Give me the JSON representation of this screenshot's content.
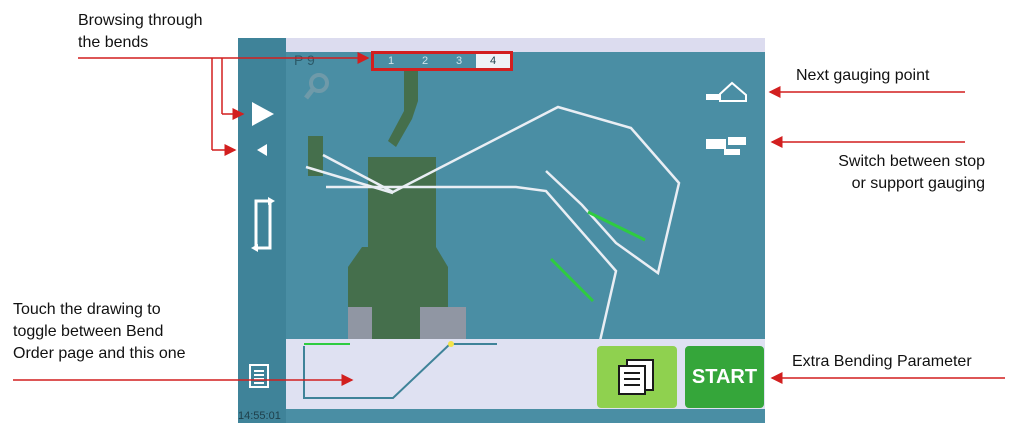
{
  "callouts": {
    "browsing": "Browsing through\nthe bends",
    "next_gauging": "Next gauging point",
    "switch_gauging": "Switch between stop\nor support gauging",
    "touch_drawing": "Touch the drawing to\ntoggle between Bend\nOrder page and this one",
    "extra_param": "Extra Bending Parameter"
  },
  "screen": {
    "program_label": "P 9",
    "bend_tabs": [
      "1",
      "2",
      "3",
      "4"
    ],
    "active_tab": "4",
    "start_label": "START",
    "clock": "14:55:01"
  },
  "colors": {
    "screen_bg": "#4a8ea4",
    "tool": "#456f4c",
    "callout_red": "#d21f1f",
    "start_green": "#35a63a",
    "list_green": "#8fd14f",
    "gauge_green": "#2ecc40"
  },
  "icons": [
    "play-icon",
    "prev-icon",
    "rotate-icon",
    "zoom-icon",
    "next-gauge-icon",
    "gauge-mode-icon",
    "list-icon",
    "param-icon"
  ]
}
